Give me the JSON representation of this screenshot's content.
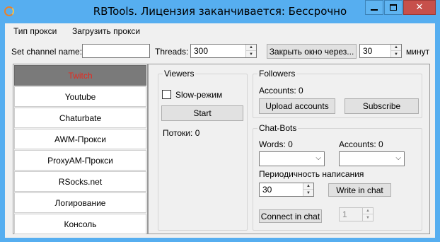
{
  "window": {
    "title": "RBTools. Лицензия заканчивается: Бессрочно",
    "close_glyph": "✕"
  },
  "menu": {
    "proxy_type": "Тип прокси",
    "load_proxy": "Загрузить прокси"
  },
  "toolbar": {
    "channel_label": "Set channel name:",
    "channel_value": "",
    "threads_label": "Threads:",
    "threads_value": "300",
    "close_after_button": "Закрыть окно через...",
    "minutes_value": "30",
    "minutes_label": "минут"
  },
  "sidebar": {
    "items": [
      {
        "label": "Twitch"
      },
      {
        "label": "Youtube"
      },
      {
        "label": "Chaturbate"
      },
      {
        "label": "AWM-Прокси"
      },
      {
        "label": "ProxyAM-Прокси"
      },
      {
        "label": "RSocks.net"
      },
      {
        "label": "Логирование"
      },
      {
        "label": "Консоль"
      }
    ]
  },
  "viewers": {
    "title": "Viewers",
    "slow_mode_label": "Slow-режим",
    "slow_mode_checked": false,
    "start_button": "Start",
    "threads_status": "Потоки: 0"
  },
  "followers": {
    "title": "Followers",
    "accounts_label": "Accounts: 0",
    "upload_button": "Upload accounts",
    "subscribe_button": "Subscribe"
  },
  "chatbots": {
    "title": "Chat-Bots",
    "words_label": "Words: 0",
    "accounts_label": "Accounts: 0",
    "words_value": "",
    "accounts_value": "",
    "period_label": "Периодичность написания",
    "period_value": "30",
    "write_button": "Write in chat",
    "connect_button": "Connect in chat",
    "connect_count_value": "1"
  },
  "icons": {
    "up": "▲",
    "down": "▼",
    "chevron": "⌵"
  },
  "colors": {
    "titlebar": "#56aef0",
    "active_tab_bg": "#7a7a7a",
    "active_tab_text": "#e8281e",
    "close_button": "#c7504b"
  }
}
